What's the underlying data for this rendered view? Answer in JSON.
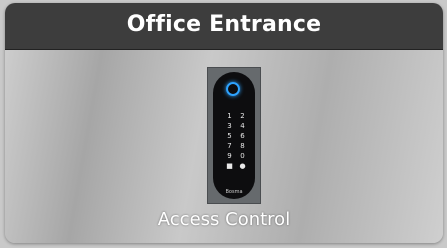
{
  "card": {
    "title": "Office Entrance",
    "caption": "Access Control"
  },
  "device": {
    "keys": [
      "1",
      "2",
      "3",
      "4",
      "5",
      "6",
      "7",
      "8",
      "9",
      "0",
      "■",
      "●"
    ],
    "brand": "Bosma",
    "ring_color": "#2ea3ff"
  },
  "colors": {
    "header_bg": "#3d3d3d",
    "title_text": "#ffffff"
  }
}
